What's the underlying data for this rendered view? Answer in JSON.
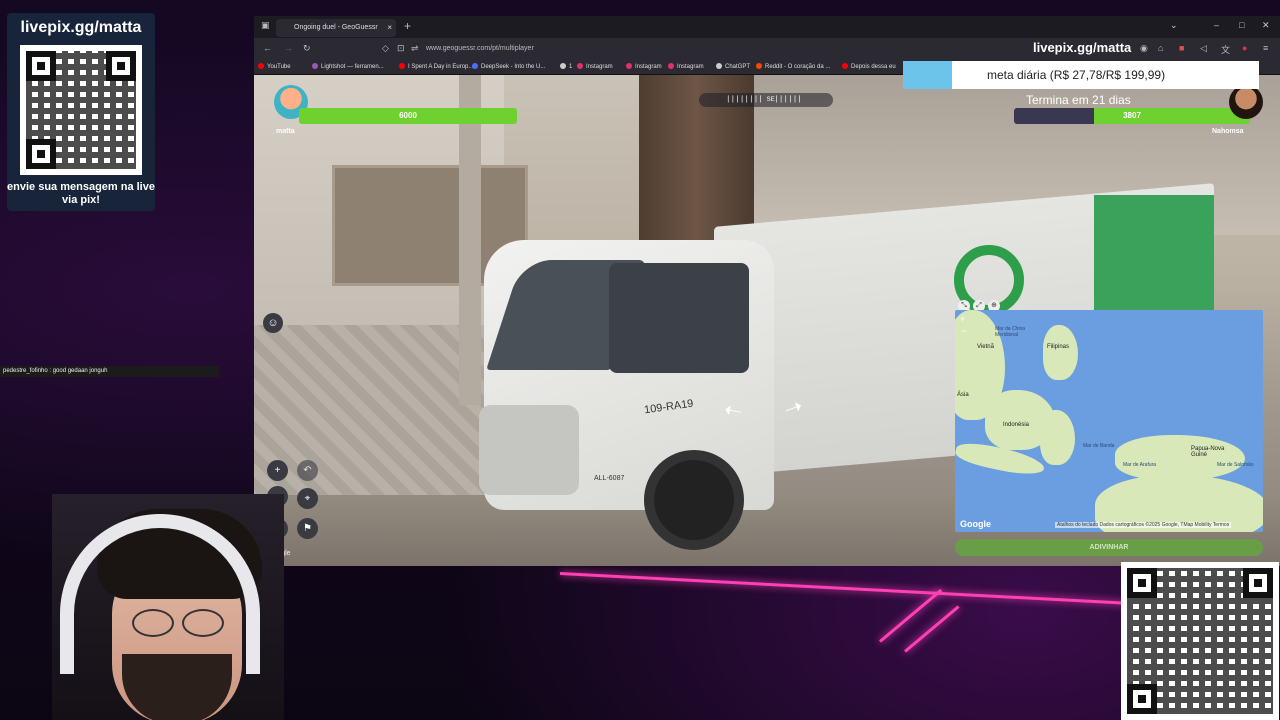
{
  "overlay": {
    "livepix_handle": "livepix.gg/matta",
    "pix_message": "envie sua mensagem na live via pix!",
    "goal_text": "meta diária (R$ 27,78/R$ 199,99)",
    "goal_progress": 0.139,
    "ends_text": "Termina em 21 dias"
  },
  "chat": {
    "message": "pedestre_fofinho : good gedaan jonguh"
  },
  "browser": {
    "tab_title": "Ongoing duel - GeoGuessr",
    "tab_close": "×",
    "new_tab": "+",
    "url": "www.geoguessr.com/pt/multiplayer",
    "bookmarks": [
      {
        "label": "YouTube",
        "color": "#ff0000"
      },
      {
        "label": "Lightshot — ferramen...",
        "color": "#9b59b6"
      },
      {
        "label": "I Spent A Day in Europ...",
        "color": "#ff0000"
      },
      {
        "label": "DeepSeek - Into the U...",
        "color": "#4d6bfe"
      },
      {
        "label": "1",
        "color": "#cccccc"
      },
      {
        "label": "Instagram",
        "color": "#e1306c"
      },
      {
        "label": "Instagram",
        "color": "#e1306c"
      },
      {
        "label": "Instagram",
        "color": "#e1306c"
      },
      {
        "label": "ChatGPT",
        "color": "#cccccc"
      },
      {
        "label": "Reddit - O coração da ...",
        "color": "#ff4500"
      },
      {
        "label": "Depois dessa eu",
        "color": "#ff0000"
      }
    ]
  },
  "game": {
    "player1": {
      "name": "matta",
      "health": "6000"
    },
    "player2": {
      "name": "Nahomsa",
      "health": "3807"
    },
    "compass_letter": "SE",
    "google_watermark": "Google",
    "guess_button": "ADIVINHAR",
    "plate_text": "109-RA19",
    "plate2": "ALL-6087"
  },
  "map": {
    "labels": {
      "vietnam": "Vietnã",
      "filipinas": "Filipinas",
      "indonesia": "Indonésia",
      "papua": "Papua-Nova Guiné",
      "malasia": "Ásia",
      "mar_china": "Mar da China Meridional",
      "mar_banda": "Mar de Banda",
      "arafura": "Mar de Arafura",
      "salomao": "Mar de Salomão"
    },
    "attribution": "Atalhos do teclado   Dados cartográficos ©2025 Google, TMap Mobility   Termos",
    "google_logo": "Google",
    "zoom_in": "+",
    "zoom_out": "−"
  },
  "colors": {
    "accent_neon": "#ff3fb4",
    "health_green": "#6fd130",
    "map_sea": "#6a9ee0",
    "guess_green": "#6a9e46"
  }
}
